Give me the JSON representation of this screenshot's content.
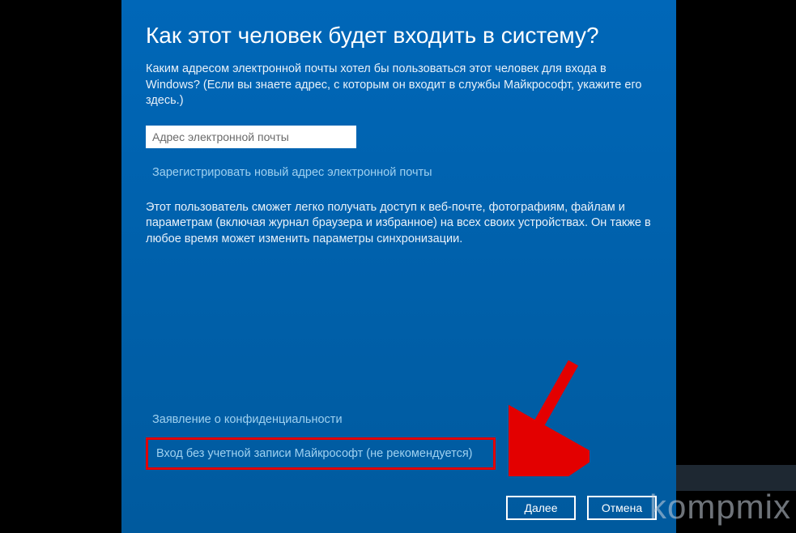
{
  "heading": "Как этот человек будет входить в систему?",
  "subtext": "Каким адресом электронной почты хотел бы пользоваться этот человек для входа в Windows? (Если вы знаете адрес, с которым он входит в службы Майкрософт, укажите его здесь.)",
  "email": {
    "placeholder": "Адрес электронной почты",
    "value": ""
  },
  "links": {
    "register": "Зарегистрировать новый адрес электронной почты",
    "privacy": "Заявление о конфиденциальности",
    "no_account": "Вход без учетной записи Майкрософт (не рекомендуется)"
  },
  "description": "Этот пользователь сможет легко получать доступ к веб-почте, фотографиям, файлам и параметрам (включая журнал браузера и избранное) на всех своих устройствах. Он также в любое время может изменить параметры синхронизации.",
  "buttons": {
    "next": "Далее",
    "cancel": "Отмена"
  },
  "watermark": "kompmix"
}
